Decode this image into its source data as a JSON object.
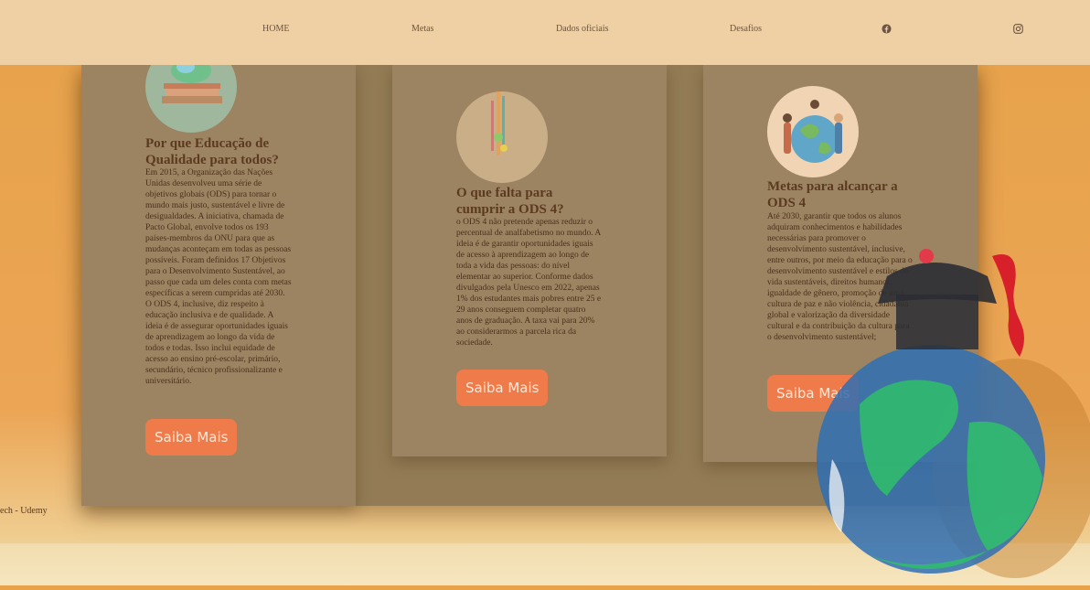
{
  "nav": {
    "items": [
      {
        "label": "HOME"
      },
      {
        "label": "Metas"
      },
      {
        "label": "Dados oficiais"
      },
      {
        "label": "Desafios"
      }
    ],
    "icons": [
      "facebook-icon",
      "instagram-icon"
    ]
  },
  "cards": [
    {
      "title": "Por que Educação de Qualidade para todos?",
      "text": "Em 2015, a Organização das Nações Unidas desenvolveu uma série de objetivos globais (ODS) para tornar o mundo mais justo, sustentável e livre de desigualdades. A iniciativa, chamada de Pacto Global, envolve todos os 193 países-membros da ONU para que as mudanças aconteçam em todas as pessoas possíveis. Foram definidos 17 Objetivos para o Desenvolvimento Sustentável, ao passo que cada um deles conta com metas específicas a serem cumpridas até 2030. O ODS 4, inclusive, diz respeito à educação inclusiva e de qualidade. A ideia é de assegurar oportunidades iguais de aprendizagem ao longo da vida de todos e todas. Isso inclui equidade de acesso ao ensino pré-escolar, primário, secundário, técnico profissionalizante e universitário.",
      "button": "Saiba Mais"
    },
    {
      "title": "O que falta para cumprir a ODS 4?",
      "text": "o ODS 4 não pretende apenas reduzir o percentual de analfabetismo no mundo. A ideia é de garantir oportunidades iguais de acesso à aprendizagem ao longo de toda a vida das pessoas: do nível elementar ao superior. Conforme dados divulgados pela Unesco em 2022, apenas 1% dos estudantes mais pobres entre 25 e 29 anos conseguem completar quatro anos de graduação. A taxa vai para 20% ao considerarmos a parcela rica da sociedade.",
      "button": "Saiba Mais"
    },
    {
      "title": "Metas para alcançar a ODS 4",
      "text": "Até 2030, garantir que todos os alunos adquiram conhecimentos e habilidades necessárias para promover o desenvolvimento sustentável, inclusive, entre outros, por meio da educação para o desenvolvimento sustentável e estilos de vida sustentáveis, direitos humanos, igualdade de gênero, promoção de uma cultura de paz e não violência, cidadania global e valorização da diversidade cultural e da contribuição da cultura para o desenvolvimento sustentável;",
      "button": "Saiba Mais"
    }
  ],
  "footer": {
    "text": "ech - Udemy"
  },
  "colors": {
    "nav_bg": "#efd0a5",
    "card_bg": "#9c8463",
    "button": "#ef7b4a",
    "title": "#5c3a1e"
  }
}
